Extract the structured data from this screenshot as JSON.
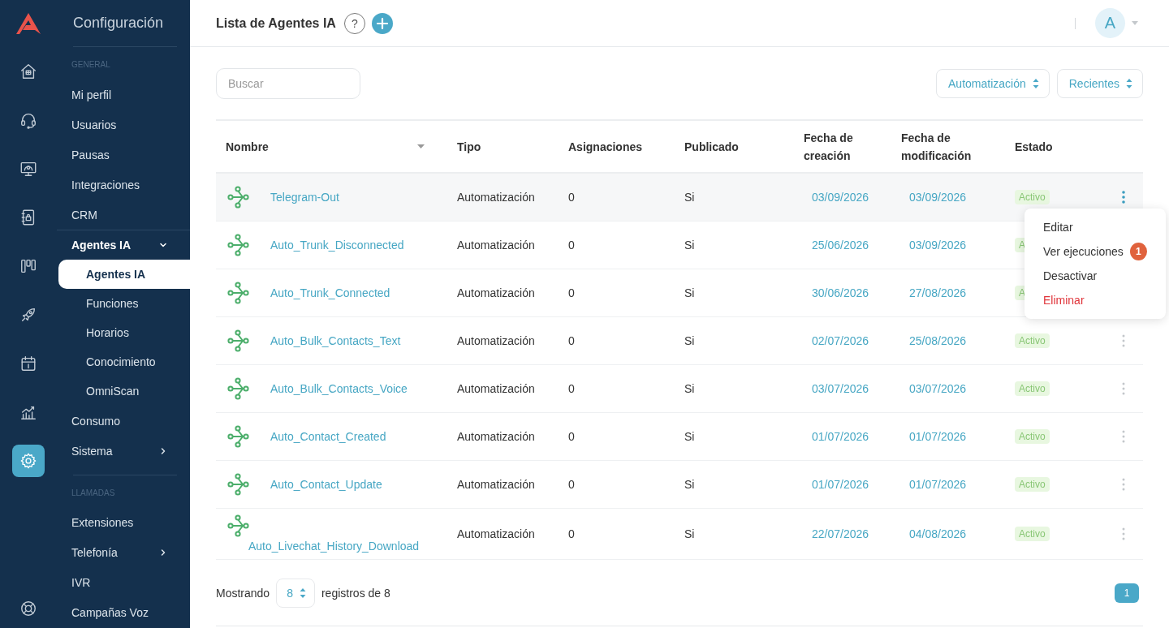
{
  "rail": {
    "items": [
      {
        "selected": false
      },
      {
        "selected": false
      },
      {
        "selected": false
      },
      {
        "selected": false
      },
      {
        "selected": false
      },
      {
        "selected": false
      },
      {
        "selected": false
      },
      {
        "selected": false
      },
      {
        "selected": true
      }
    ]
  },
  "sidebar": {
    "title": "Configuración",
    "sections": [
      {
        "label": "GENERAL",
        "items": [
          {
            "label": "Mi perfil",
            "selected": false
          },
          {
            "label": "Usuarios",
            "selected": false
          },
          {
            "label": "Pausas",
            "selected": false
          },
          {
            "label": "Integraciones",
            "selected": false
          },
          {
            "label": "CRM",
            "selected": false
          },
          {
            "label": "Agentes IA",
            "selected": false,
            "expanded": true,
            "children": [
              {
                "label": "Agentes IA",
                "selected": true
              },
              {
                "label": "Funciones",
                "selected": false
              },
              {
                "label": "Horarios",
                "selected": false
              },
              {
                "label": "Conocimiento",
                "selected": false
              },
              {
                "label": "OmniScan",
                "selected": false
              }
            ]
          },
          {
            "label": "Consumo",
            "selected": false
          },
          {
            "label": "Sistema",
            "selected": false,
            "expanded": false
          }
        ]
      },
      {
        "label": "LLAMADAS",
        "items": [
          {
            "label": "Extensiones",
            "selected": false
          },
          {
            "label": "Telefonía",
            "selected": false,
            "expanded": false
          },
          {
            "label": "IVR",
            "selected": false
          },
          {
            "label": "Campañas Voz",
            "selected": false
          }
        ]
      }
    ]
  },
  "header": {
    "title": "Lista de Agentes IA",
    "help_label": "?",
    "avatar": "A"
  },
  "toolbar": {
    "search": {
      "placeholder": "Buscar"
    },
    "filters": [
      {
        "value": "Automatización"
      },
      {
        "value": "Recientes"
      }
    ]
  },
  "table": {
    "columns": [
      {
        "label": "Nombre",
        "sorted": true
      },
      {
        "label": "Tipo",
        "sorted": false
      },
      {
        "label": "Asignaciones",
        "sorted": false
      },
      {
        "label": "Publicado",
        "sorted": false
      },
      {
        "label": "Fecha de creación",
        "sorted": false
      },
      {
        "label": "Fecha de modificación",
        "sorted": false
      },
      {
        "label": "Estado",
        "sorted": false
      }
    ],
    "rows": [
      {
        "name": "Telegram-Out",
        "type": "Automatización",
        "assignments": "0",
        "published": "Si",
        "created": "03/09/2026",
        "modified": "03/09/2026",
        "status": "Activo",
        "action_menu": {
          "items": [
            {
              "label": "Editar",
              "kind": "normal"
            },
            {
              "label": "Ver ejecuciones",
              "kind": "normal",
              "badge": "1"
            },
            {
              "label": "Desactivar",
              "kind": "normal"
            },
            {
              "label": "Eliminar",
              "kind": "danger"
            }
          ]
        }
      },
      {
        "name": "Auto_Trunk_Disconnected",
        "type": "Automatización",
        "assignments": "0",
        "published": "Si",
        "created": "25/06/2026",
        "modified": "03/09/2026",
        "status": "A"
      },
      {
        "name": "Auto_Trunk_Connected",
        "type": "Automatización",
        "assignments": "0",
        "published": "Si",
        "created": "30/06/2026",
        "modified": "27/08/2026",
        "status": "A"
      },
      {
        "name": "Auto_Bulk_Contacts_Text",
        "type": "Automatización",
        "assignments": "0",
        "published": "Si",
        "created": "02/07/2026",
        "modified": "25/08/2026",
        "status": "Activo"
      },
      {
        "name": "Auto_Bulk_Contacts_Voice",
        "type": "Automatización",
        "assignments": "0",
        "published": "Si",
        "created": "03/07/2026",
        "modified": "03/07/2026",
        "status": "Activo"
      },
      {
        "name": "Auto_Contact_Created",
        "type": "Automatización",
        "assignments": "0",
        "published": "Si",
        "created": "01/07/2026",
        "modified": "01/07/2026",
        "status": "Activo"
      },
      {
        "name": "Auto_Contact_Update",
        "type": "Automatización",
        "assignments": "0",
        "published": "Si",
        "created": "01/07/2026",
        "modified": "01/07/2026",
        "status": "Activo"
      },
      {
        "name": "Auto_Livechat_History_Download",
        "type": "Automatización",
        "assignments": "0",
        "published": "Si",
        "created": "22/07/2026",
        "modified": "04/08/2026",
        "status": "Activo"
      }
    ]
  },
  "footer": {
    "showing_label": "Mostrando",
    "page_size": "8",
    "records_label": "registros de 8",
    "pages": [
      {
        "label": "1",
        "selected": true
      }
    ]
  }
}
